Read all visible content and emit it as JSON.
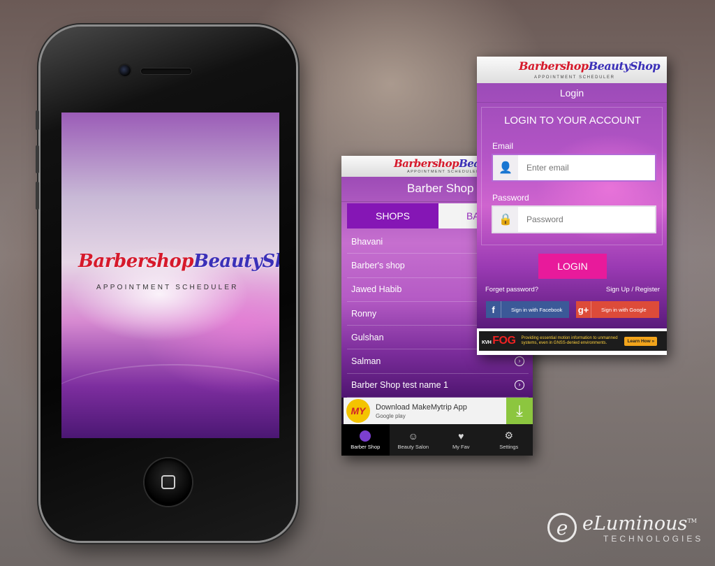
{
  "brand": {
    "logo_part1": "Barbershop",
    "logo_part2": "BeautyShop",
    "subtitle": "APPOINTMENT SCHEDULER",
    "colors": {
      "logo_red": "#d6192b",
      "logo_blue": "#3a2fb8",
      "purple": "#8516b5",
      "pink_button": "#e81a9b"
    }
  },
  "phone": {
    "icons": {
      "camera": "camera-icon",
      "home": "home-button-icon"
    }
  },
  "shop_screen": {
    "title": "Barber Shop",
    "tabs": [
      {
        "label": "SHOPS",
        "active": true
      },
      {
        "label": "BA",
        "active": false
      }
    ],
    "shops": [
      {
        "name": "Bhavani"
      },
      {
        "name": "Barber's shop"
      },
      {
        "name": "Jawed Habib"
      },
      {
        "name": "Ronny"
      },
      {
        "name": "Gulshan"
      },
      {
        "name": "Salman"
      },
      {
        "name": "Barber Shop test name 1"
      }
    ],
    "ad": {
      "logo": "MY",
      "text": "Download MakeMytrip App",
      "sub": "Google play",
      "icon": "download-icon"
    },
    "nav": [
      {
        "label": "Barber Shop",
        "icon": "barber-face-icon",
        "active": true
      },
      {
        "label": "Beauty Salon",
        "icon": "salon-icon",
        "active": false
      },
      {
        "label": "My Fav",
        "icon": "heart-icon",
        "active": false
      },
      {
        "label": "Settings",
        "icon": "gear-icon",
        "active": false
      }
    ]
  },
  "login_screen": {
    "title": "Login",
    "heading": "LOGIN TO YOUR ACCOUNT",
    "email_label": "Email",
    "email_placeholder": "Enter email",
    "password_label": "Password",
    "password_placeholder": "Password",
    "login_button": "LOGIN",
    "forgot": "Forget password?",
    "signup": "Sign Up / Register",
    "facebook_button": "Sign in with Facebook",
    "google_button": "Sign in with Google",
    "banner": {
      "brand_small": "KVH",
      "brand": "FOG",
      "message": "Providing essential motion information to unmanned systems, even in GNSS-denied environments.",
      "cta": "Learn How »"
    }
  },
  "watermark": {
    "mark": "e",
    "name": "eLuminous",
    "tm": "TM",
    "tagline": "TECHNOLOGIES"
  }
}
